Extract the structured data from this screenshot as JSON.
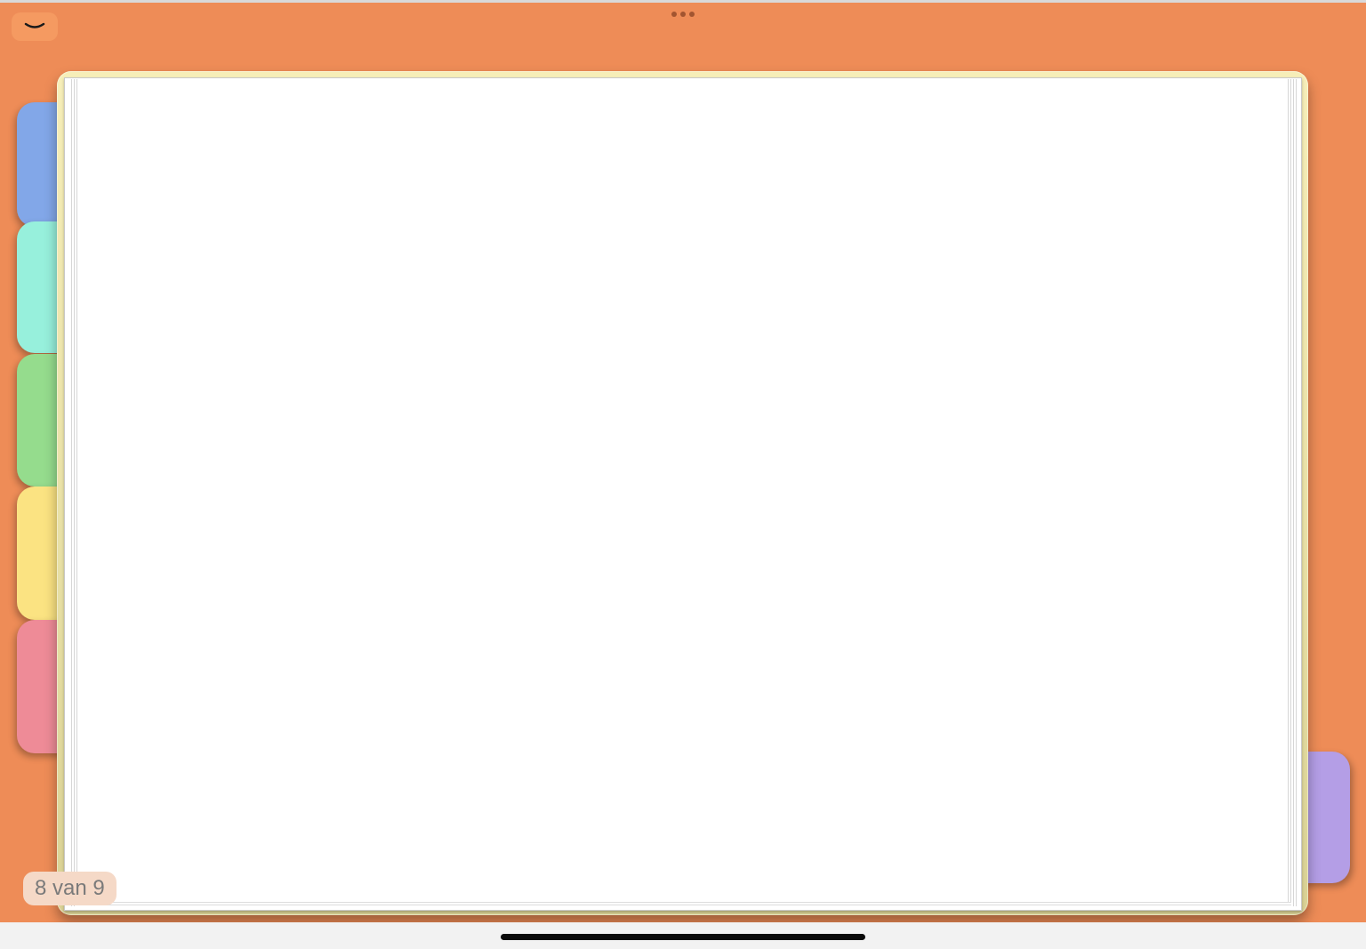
{
  "toolbar": {
    "collapse_icon": "chevron-down-icon",
    "more_icon": "ellipsis-icon"
  },
  "tabs": [
    {
      "color": "#82a7e8"
    },
    {
      "color": "#97f0dc"
    },
    {
      "color": "#95dc8d"
    },
    {
      "color": "#fbe382"
    },
    {
      "color": "#ee8b97"
    },
    {
      "color": "#b49ee6"
    }
  ],
  "colors": {
    "background": "#ee8c57",
    "notebook_cover": "#f6eeb8",
    "page": "#ffffff"
  },
  "page_counter": {
    "label": "8 van 9"
  }
}
